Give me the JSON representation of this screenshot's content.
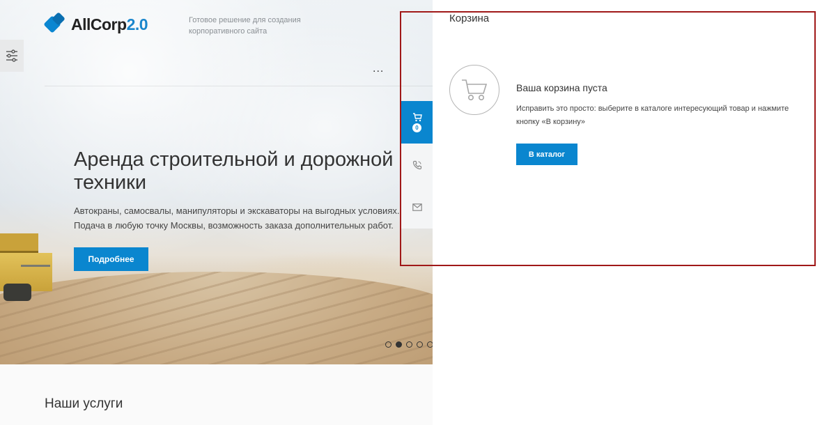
{
  "header": {
    "logo_name": "AllCorp",
    "logo_version": "2.0",
    "tagline": "Готовое решение для создания корпоративного сайта",
    "more_label": "..."
  },
  "hero": {
    "title_line1": "Аренда строительной и дорожной",
    "title_line2": "техники",
    "text_line1": "Автокраны, самосвалы, манипуляторы и экскаваторы на выгодных условиях.",
    "text_line2": "Подача в любую точку Москвы, возможность заказа дополнительных работ.",
    "button_label": "Подробнее",
    "slider": {
      "total": 5,
      "active_index": 1
    }
  },
  "services": {
    "title": "Наши услуги"
  },
  "side_panel": {
    "tabs": [
      {
        "name": "cart",
        "icon": "cart-icon",
        "count": "0",
        "active": true
      },
      {
        "name": "phone",
        "icon": "phone-icon",
        "active": false
      },
      {
        "name": "mail",
        "icon": "mail-icon",
        "active": false
      }
    ],
    "title": "Корзина",
    "empty_title": "Ваша корзина пуста",
    "empty_text": "Исправить это просто: выберите в каталоге интересующий товар и нажмите кнопку «В корзину»",
    "catalog_button": "В каталог"
  },
  "colors": {
    "accent": "#0a86cf",
    "highlight_border": "#a01818"
  }
}
